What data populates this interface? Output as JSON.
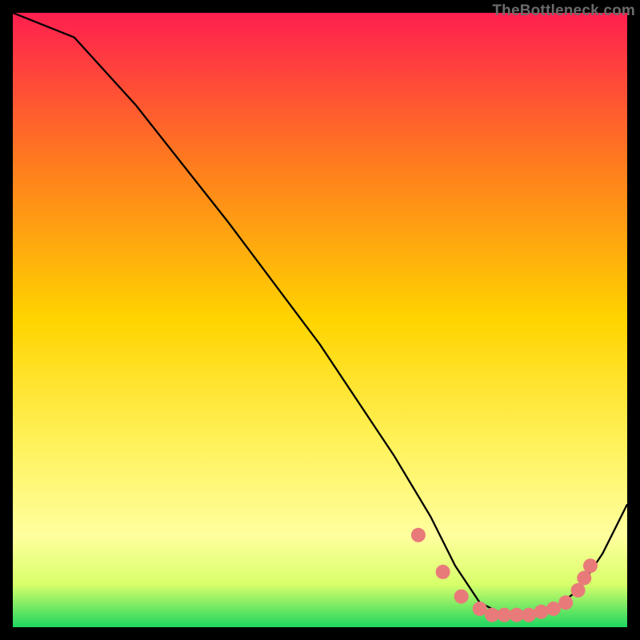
{
  "watermark": "TheBottleneck.com",
  "chart_data": {
    "type": "line",
    "title": "",
    "xlabel": "",
    "ylabel": "",
    "xlim": [
      0,
      100
    ],
    "ylim": [
      0,
      100
    ],
    "series": [
      {
        "name": "curve",
        "x": [
          0,
          10,
          20,
          35,
          50,
          62,
          68,
          72,
          76,
          80,
          84,
          88,
          92,
          96,
          100
        ],
        "values": [
          100,
          96,
          85,
          66,
          46,
          28,
          18,
          10,
          4,
          2,
          2,
          3,
          6,
          12,
          20
        ]
      }
    ],
    "markers": {
      "name": "highlight-dots",
      "x": [
        66,
        70,
        73,
        76,
        78,
        80,
        82,
        84,
        86,
        88,
        90,
        92,
        93,
        94
      ],
      "values": [
        15,
        9,
        5,
        3,
        2,
        2,
        2,
        2,
        2.5,
        3,
        4,
        6,
        8,
        10
      ]
    },
    "gradient_colors": {
      "top": "#ff1f4f",
      "mid_upper": "#ff7a1f",
      "mid": "#ffd400",
      "mid_lower": "#fff25a",
      "lower": "#ffff9e",
      "band": "#d8ff6a",
      "bottom": "#1dd65f"
    },
    "curve_color": "#000000",
    "marker_color": "#e97a7a",
    "marker_radius": 9
  }
}
